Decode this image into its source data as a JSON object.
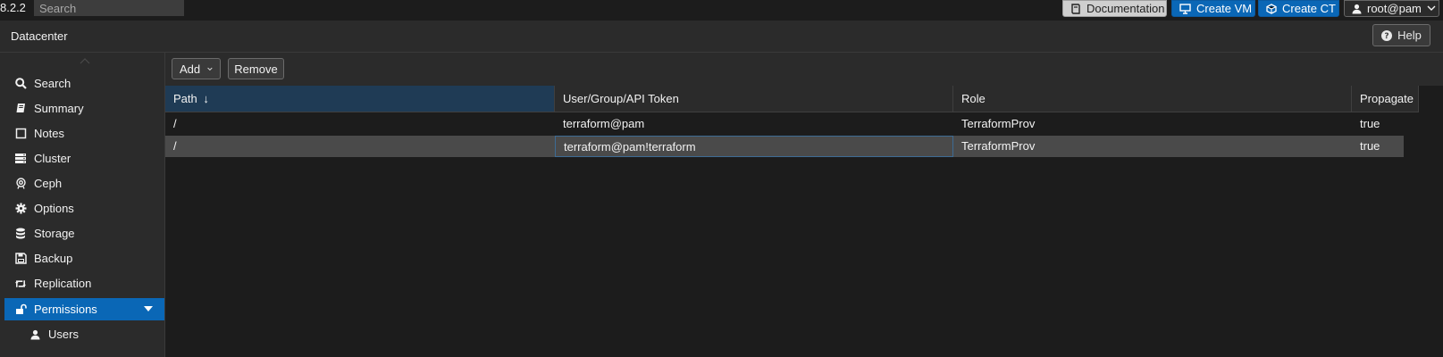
{
  "topbar": {
    "version": "8.2.2",
    "search_placeholder": "Search",
    "documentation_label": "Documentation",
    "create_vm_label": "Create VM",
    "create_ct_label": "Create CT",
    "user_label": "root@pam"
  },
  "header": {
    "title": "Datacenter",
    "help_label": "Help"
  },
  "sidebar": {
    "items": [
      {
        "label": "Search",
        "icon": "search-icon"
      },
      {
        "label": "Summary",
        "icon": "book-icon"
      },
      {
        "label": "Notes",
        "icon": "note-icon"
      },
      {
        "label": "Cluster",
        "icon": "server-icon"
      },
      {
        "label": "Ceph",
        "icon": "ceph-icon"
      },
      {
        "label": "Options",
        "icon": "gear-icon"
      },
      {
        "label": "Storage",
        "icon": "database-icon"
      },
      {
        "label": "Backup",
        "icon": "floppy-icon"
      },
      {
        "label": "Replication",
        "icon": "retweet-icon"
      },
      {
        "label": "Permissions",
        "icon": "unlock-icon",
        "active": true
      },
      {
        "label": "Users",
        "icon": "user-icon"
      }
    ]
  },
  "toolbar": {
    "add_label": "Add",
    "remove_label": "Remove"
  },
  "grid": {
    "columns": [
      "Path",
      "User/Group/API Token",
      "Role",
      "Propagate"
    ],
    "sort_indicator": "↓",
    "rows": [
      {
        "path": "/",
        "user": "terraform@pam",
        "role": "TerraformProv",
        "propagate": "true"
      },
      {
        "path": "/",
        "user": "terraform@pam!terraform",
        "role": "TerraformProv",
        "propagate": "true"
      }
    ]
  },
  "colors": {
    "accent": "#0a67b6",
    "sorted_header": "#1f3b55",
    "selected_row": "#4a4a4a",
    "panel": "#2b2b2b",
    "background": "#1c1c1c"
  }
}
